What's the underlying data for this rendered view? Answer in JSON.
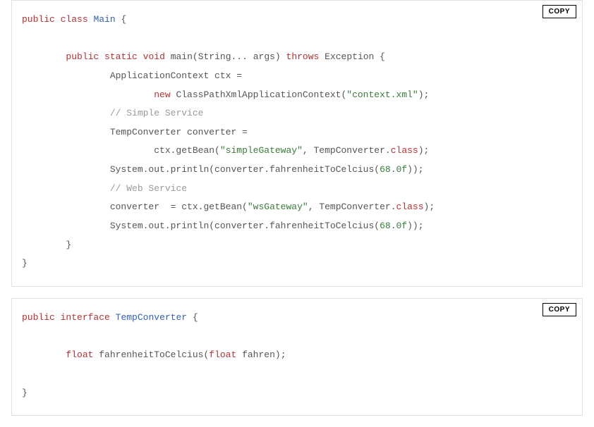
{
  "copy_label": "COPY",
  "blocks": [
    {
      "id": "block-main",
      "lines": [
        [
          {
            "cls": "tok-kw",
            "t": "public"
          },
          {
            "cls": "tok-plain",
            "t": " "
          },
          {
            "cls": "tok-kw",
            "t": "class"
          },
          {
            "cls": "tok-plain",
            "t": " "
          },
          {
            "cls": "tok-class",
            "t": "Main"
          },
          {
            "cls": "tok-plain",
            "t": " {"
          }
        ],
        [],
        [
          {
            "cls": "tok-plain",
            "t": "        "
          },
          {
            "cls": "tok-kw",
            "t": "public"
          },
          {
            "cls": "tok-plain",
            "t": " "
          },
          {
            "cls": "tok-kw",
            "t": "static"
          },
          {
            "cls": "tok-plain",
            "t": " "
          },
          {
            "cls": "tok-kw",
            "t": "void"
          },
          {
            "cls": "tok-plain",
            "t": " main(String... args) "
          },
          {
            "cls": "tok-kw",
            "t": "throws"
          },
          {
            "cls": "tok-plain",
            "t": " Exception {"
          }
        ],
        [
          {
            "cls": "tok-plain",
            "t": "                ApplicationContext ctx ="
          }
        ],
        [
          {
            "cls": "tok-plain",
            "t": "                        "
          },
          {
            "cls": "tok-kw",
            "t": "new"
          },
          {
            "cls": "tok-plain",
            "t": " ClassPathXmlApplicationContext("
          },
          {
            "cls": "tok-str",
            "t": "\"context.xml\""
          },
          {
            "cls": "tok-plain",
            "t": ");"
          }
        ],
        [
          {
            "cls": "tok-plain",
            "t": "                "
          },
          {
            "cls": "tok-comment",
            "t": "// Simple Service"
          }
        ],
        [
          {
            "cls": "tok-plain",
            "t": "                TempConverter converter ="
          }
        ],
        [
          {
            "cls": "tok-plain",
            "t": "                        ctx.getBean("
          },
          {
            "cls": "tok-str",
            "t": "\"simpleGateway\""
          },
          {
            "cls": "tok-plain",
            "t": ", TempConverter."
          },
          {
            "cls": "tok-kw",
            "t": "class"
          },
          {
            "cls": "tok-plain",
            "t": ");"
          }
        ],
        [
          {
            "cls": "tok-plain",
            "t": "                System.out.println(converter.fahrenheitToCelcius("
          },
          {
            "cls": "tok-num",
            "t": "68.0f"
          },
          {
            "cls": "tok-plain",
            "t": "));"
          }
        ],
        [
          {
            "cls": "tok-plain",
            "t": "                "
          },
          {
            "cls": "tok-comment",
            "t": "// Web Service"
          }
        ],
        [
          {
            "cls": "tok-plain",
            "t": "                converter  = ctx.getBean("
          },
          {
            "cls": "tok-str",
            "t": "\"wsGateway\""
          },
          {
            "cls": "tok-plain",
            "t": ", TempConverter."
          },
          {
            "cls": "tok-kw",
            "t": "class"
          },
          {
            "cls": "tok-plain",
            "t": ");"
          }
        ],
        [
          {
            "cls": "tok-plain",
            "t": "                System.out.println(converter.fahrenheitToCelcius("
          },
          {
            "cls": "tok-num",
            "t": "68.0f"
          },
          {
            "cls": "tok-plain",
            "t": "));"
          }
        ],
        [
          {
            "cls": "tok-plain",
            "t": "        }"
          }
        ],
        [
          {
            "cls": "tok-plain",
            "t": "}"
          }
        ]
      ]
    },
    {
      "id": "block-interface",
      "lines": [
        [
          {
            "cls": "tok-kw",
            "t": "public"
          },
          {
            "cls": "tok-plain",
            "t": " "
          },
          {
            "cls": "tok-kw",
            "t": "interface"
          },
          {
            "cls": "tok-plain",
            "t": " "
          },
          {
            "cls": "tok-class",
            "t": "TempConverter"
          },
          {
            "cls": "tok-plain",
            "t": " {"
          }
        ],
        [],
        [
          {
            "cls": "tok-plain",
            "t": "        "
          },
          {
            "cls": "tok-kw",
            "t": "float"
          },
          {
            "cls": "tok-plain",
            "t": " fahrenheitToCelcius("
          },
          {
            "cls": "tok-kw",
            "t": "float"
          },
          {
            "cls": "tok-plain",
            "t": " fahren);"
          }
        ],
        [],
        [
          {
            "cls": "tok-plain",
            "t": "}"
          }
        ]
      ]
    }
  ]
}
